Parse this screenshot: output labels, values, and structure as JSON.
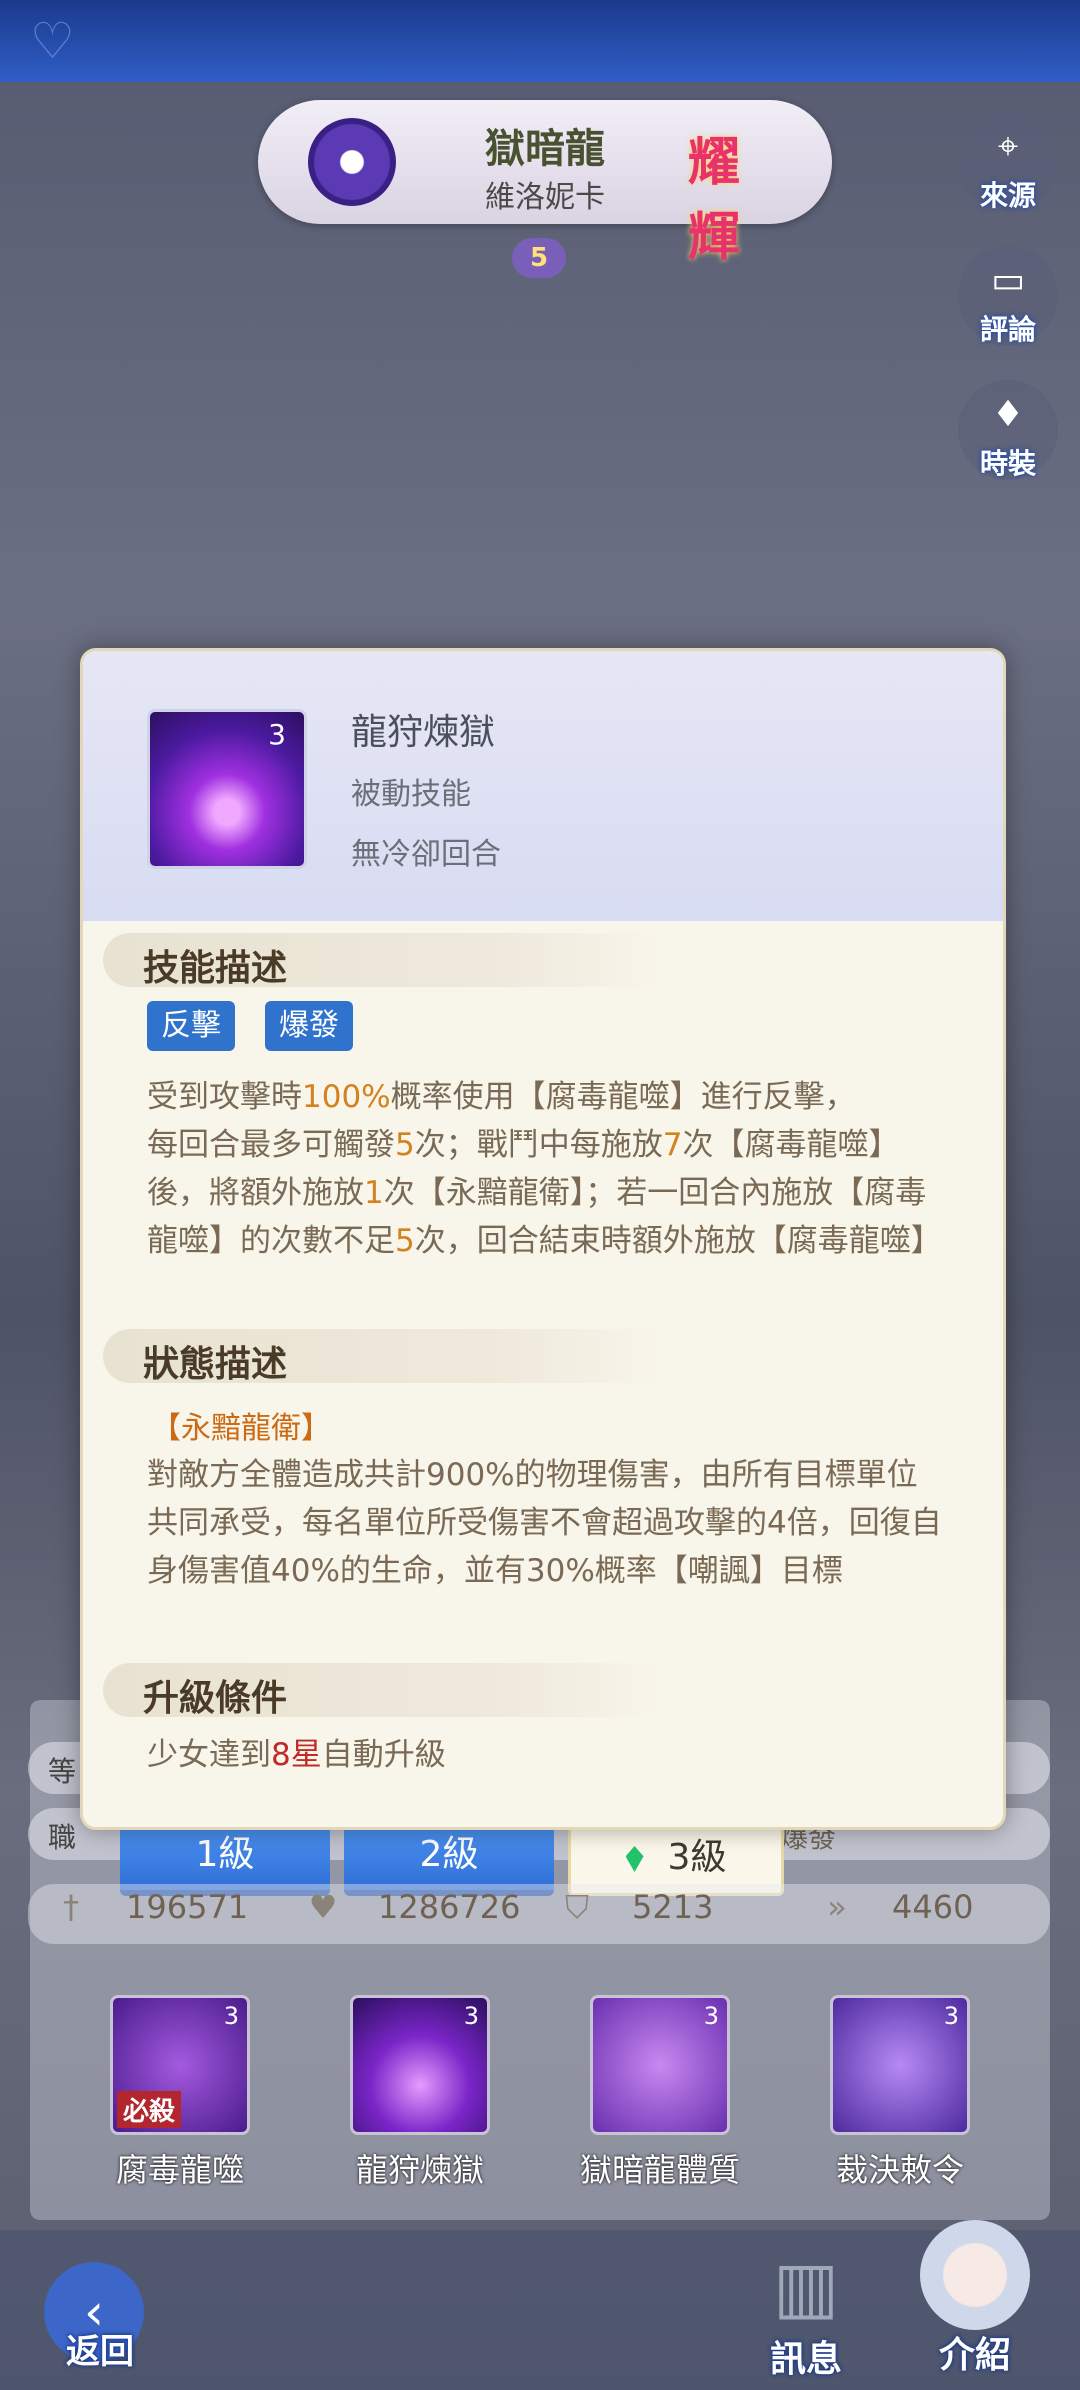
{
  "header": {
    "character_title": "獄暗龍",
    "character_name": "維洛妮卡",
    "rank_label": "耀輝",
    "star_level": "5"
  },
  "side_buttons": [
    {
      "label": "來源",
      "icon": "location-pin-icon"
    },
    {
      "label": "評論",
      "icon": "chat-bubble-icon"
    },
    {
      "label": "時裝",
      "icon": "costume-icon"
    }
  ],
  "dialog": {
    "skill_level": "3",
    "skill_name": "龍狩煉獄",
    "skill_type": "被動技能",
    "cooldown": "無冷卻回合",
    "section_desc": "技能描述",
    "tags": [
      "反擊",
      "爆發"
    ],
    "desc": {
      "p1": "受到攻擊時",
      "h1": "100%",
      "p2": "概率使用【腐毒龍噬】進行反擊，",
      "p3": "每回合最多可觸發",
      "h2": "5",
      "p4": "次；戰鬥中每施放",
      "h3": "7",
      "p5": "次【腐毒龍噬】後，將額外施放",
      "h4": "1",
      "p6": "次【永黯龍衛】；若一回合內施放【腐毒龍噬】的次數不足",
      "h5": "5",
      "p7": "次，回合結束時額外施放【腐毒龍噬】"
    },
    "section_status": "狀態描述",
    "status_name": "【永黯龍衛】",
    "status_desc": "對敵方全體造成共計900%的物理傷害，由所有目標單位共同承受，每名單位所受傷害不會超過攻擊的4倍，回復自身傷害值40%的生命，並有30%概率【嘲諷】目標",
    "section_upgrade": "升級條件",
    "upgrade_p1": "少女達到",
    "upgrade_h": "8星",
    "upgrade_p2": "自動升級"
  },
  "info_rows": {
    "row1_label": "等",
    "row2_label": "職",
    "row2_value": "爆發"
  },
  "level_tabs": [
    "1級",
    "2級",
    "3級"
  ],
  "stats": [
    {
      "icon": "attack-icon",
      "value": "196571"
    },
    {
      "icon": "heart-icon",
      "value": "1286726"
    },
    {
      "icon": "shield-icon",
      "value": "5213"
    },
    {
      "icon": "speed-icon",
      "value": "4460"
    }
  ],
  "skills": [
    {
      "name": "腐毒龍噬",
      "level": "3",
      "tag": "必殺"
    },
    {
      "name": "龍狩煉獄",
      "level": "3",
      "tag": ""
    },
    {
      "name": "獄暗龍體質",
      "level": "3",
      "tag": ""
    },
    {
      "name": "裁決敕令",
      "level": "3",
      "tag": ""
    }
  ],
  "bottom_nav": {
    "back": "返回",
    "info": "訊息",
    "intro": "介紹"
  }
}
